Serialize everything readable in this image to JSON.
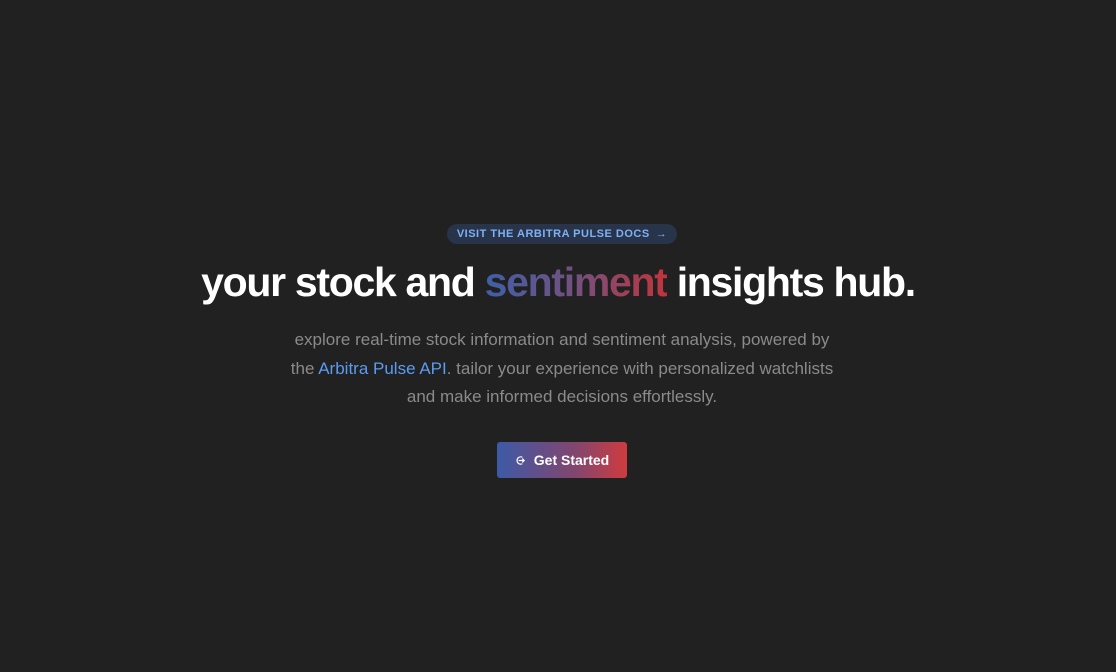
{
  "docs_pill": {
    "label": "VISIT THE ARBITRA PULSE DOCS",
    "arrow_icon": "arrow-right-icon"
  },
  "headline": {
    "before": "your stock and",
    "accent": "sentiment",
    "after": "insights hub."
  },
  "subtitle": {
    "line1": "explore real-time stock information and sentiment analysis, powered by",
    "pre_link": "the",
    "link": "Arbitra Pulse API",
    "post_link": ". tailor your experience with personalized watchlists",
    "line3": "and make informed decisions effortlessly."
  },
  "cta": {
    "label": "Get Started",
    "icon": "login-icon"
  },
  "colors": {
    "background": "#212121",
    "pill_background": "#27344a",
    "pill_text": "#7fb0f5",
    "link": "#5b9bf0",
    "gradient_start": "#3d5aa6",
    "gradient_end": "#cf3b3f"
  }
}
